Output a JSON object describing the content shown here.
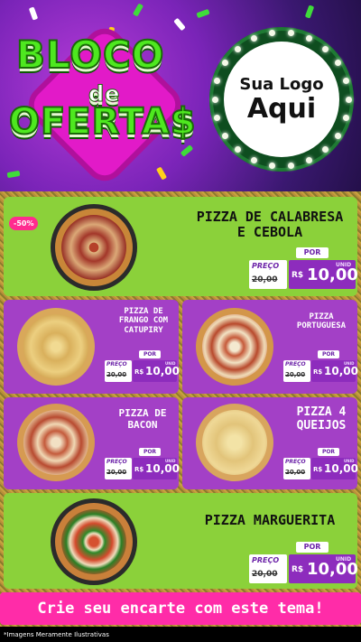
{
  "header": {
    "title_line1": "BLOCO",
    "title_line2": "de",
    "title_line3": "OFERTA$",
    "logo_line1": "Sua Logo",
    "logo_line2": "Aqui"
  },
  "currency": "R$",
  "price_tag_label": "PREÇO",
  "per_label": "POR",
  "unit_label": "UNID",
  "products": [
    {
      "name_l1": "PIZZA DE CALABRESA",
      "name_l2": "E CEBOLA",
      "badge": "-50%",
      "old_price": "20,00",
      "price": "10,00"
    },
    {
      "name_l1": "PIZZA DE",
      "name_l2": "FRANGO COM",
      "name_l3": "CATUPIRY",
      "old_price": "20,00",
      "price": "10,00"
    },
    {
      "name_l1": "PIZZA",
      "name_l2": "PORTUGUESA",
      "old_price": "20,00",
      "price": "10,00"
    },
    {
      "name_l1": "PIZZA DE",
      "name_l2": "BACON",
      "old_price": "20,00",
      "price": "10,00"
    },
    {
      "name_l1": "PIZZA 4",
      "name_l2": "QUEIJOS",
      "old_price": "20,00",
      "price": "10,00"
    },
    {
      "name_l1": "PIZZA MARGUERITA",
      "old_price": "20,00",
      "price": "10,00"
    }
  ],
  "cta": "Crie seu encarte com este tema!",
  "footer": "*Imagens Meramente Ilustrativas",
  "colors": {
    "green": "#8bd13a",
    "purple": "#a340c6",
    "pink": "#ff2ca8",
    "price_purple": "#8d2cbd"
  }
}
